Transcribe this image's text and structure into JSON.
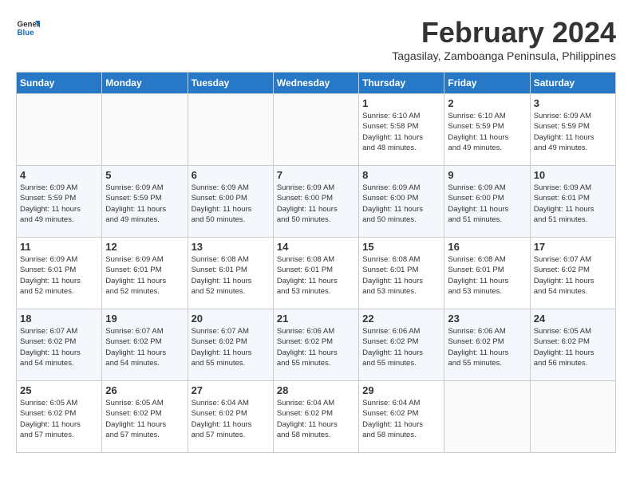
{
  "header": {
    "logo_general": "General",
    "logo_blue": "Blue",
    "title": "February 2024",
    "subtitle": "Tagasilay, Zamboanga Peninsula, Philippines"
  },
  "days_of_week": [
    "Sunday",
    "Monday",
    "Tuesday",
    "Wednesday",
    "Thursday",
    "Friday",
    "Saturday"
  ],
  "weeks": [
    [
      {
        "day": "",
        "info": ""
      },
      {
        "day": "",
        "info": ""
      },
      {
        "day": "",
        "info": ""
      },
      {
        "day": "",
        "info": ""
      },
      {
        "day": "1",
        "info": "Sunrise: 6:10 AM\nSunset: 5:58 PM\nDaylight: 11 hours\nand 48 minutes."
      },
      {
        "day": "2",
        "info": "Sunrise: 6:10 AM\nSunset: 5:59 PM\nDaylight: 11 hours\nand 49 minutes."
      },
      {
        "day": "3",
        "info": "Sunrise: 6:09 AM\nSunset: 5:59 PM\nDaylight: 11 hours\nand 49 minutes."
      }
    ],
    [
      {
        "day": "4",
        "info": "Sunrise: 6:09 AM\nSunset: 5:59 PM\nDaylight: 11 hours\nand 49 minutes."
      },
      {
        "day": "5",
        "info": "Sunrise: 6:09 AM\nSunset: 5:59 PM\nDaylight: 11 hours\nand 49 minutes."
      },
      {
        "day": "6",
        "info": "Sunrise: 6:09 AM\nSunset: 6:00 PM\nDaylight: 11 hours\nand 50 minutes."
      },
      {
        "day": "7",
        "info": "Sunrise: 6:09 AM\nSunset: 6:00 PM\nDaylight: 11 hours\nand 50 minutes."
      },
      {
        "day": "8",
        "info": "Sunrise: 6:09 AM\nSunset: 6:00 PM\nDaylight: 11 hours\nand 50 minutes."
      },
      {
        "day": "9",
        "info": "Sunrise: 6:09 AM\nSunset: 6:00 PM\nDaylight: 11 hours\nand 51 minutes."
      },
      {
        "day": "10",
        "info": "Sunrise: 6:09 AM\nSunset: 6:01 PM\nDaylight: 11 hours\nand 51 minutes."
      }
    ],
    [
      {
        "day": "11",
        "info": "Sunrise: 6:09 AM\nSunset: 6:01 PM\nDaylight: 11 hours\nand 52 minutes."
      },
      {
        "day": "12",
        "info": "Sunrise: 6:09 AM\nSunset: 6:01 PM\nDaylight: 11 hours\nand 52 minutes."
      },
      {
        "day": "13",
        "info": "Sunrise: 6:08 AM\nSunset: 6:01 PM\nDaylight: 11 hours\nand 52 minutes."
      },
      {
        "day": "14",
        "info": "Sunrise: 6:08 AM\nSunset: 6:01 PM\nDaylight: 11 hours\nand 53 minutes."
      },
      {
        "day": "15",
        "info": "Sunrise: 6:08 AM\nSunset: 6:01 PM\nDaylight: 11 hours\nand 53 minutes."
      },
      {
        "day": "16",
        "info": "Sunrise: 6:08 AM\nSunset: 6:01 PM\nDaylight: 11 hours\nand 53 minutes."
      },
      {
        "day": "17",
        "info": "Sunrise: 6:07 AM\nSunset: 6:02 PM\nDaylight: 11 hours\nand 54 minutes."
      }
    ],
    [
      {
        "day": "18",
        "info": "Sunrise: 6:07 AM\nSunset: 6:02 PM\nDaylight: 11 hours\nand 54 minutes."
      },
      {
        "day": "19",
        "info": "Sunrise: 6:07 AM\nSunset: 6:02 PM\nDaylight: 11 hours\nand 54 minutes."
      },
      {
        "day": "20",
        "info": "Sunrise: 6:07 AM\nSunset: 6:02 PM\nDaylight: 11 hours\nand 55 minutes."
      },
      {
        "day": "21",
        "info": "Sunrise: 6:06 AM\nSunset: 6:02 PM\nDaylight: 11 hours\nand 55 minutes."
      },
      {
        "day": "22",
        "info": "Sunrise: 6:06 AM\nSunset: 6:02 PM\nDaylight: 11 hours\nand 55 minutes."
      },
      {
        "day": "23",
        "info": "Sunrise: 6:06 AM\nSunset: 6:02 PM\nDaylight: 11 hours\nand 55 minutes."
      },
      {
        "day": "24",
        "info": "Sunrise: 6:05 AM\nSunset: 6:02 PM\nDaylight: 11 hours\nand 56 minutes."
      }
    ],
    [
      {
        "day": "25",
        "info": "Sunrise: 6:05 AM\nSunset: 6:02 PM\nDaylight: 11 hours\nand 57 minutes."
      },
      {
        "day": "26",
        "info": "Sunrise: 6:05 AM\nSunset: 6:02 PM\nDaylight: 11 hours\nand 57 minutes."
      },
      {
        "day": "27",
        "info": "Sunrise: 6:04 AM\nSunset: 6:02 PM\nDaylight: 11 hours\nand 57 minutes."
      },
      {
        "day": "28",
        "info": "Sunrise: 6:04 AM\nSunset: 6:02 PM\nDaylight: 11 hours\nand 58 minutes."
      },
      {
        "day": "29",
        "info": "Sunrise: 6:04 AM\nSunset: 6:02 PM\nDaylight: 11 hours\nand 58 minutes."
      },
      {
        "day": "",
        "info": ""
      },
      {
        "day": "",
        "info": ""
      }
    ]
  ]
}
